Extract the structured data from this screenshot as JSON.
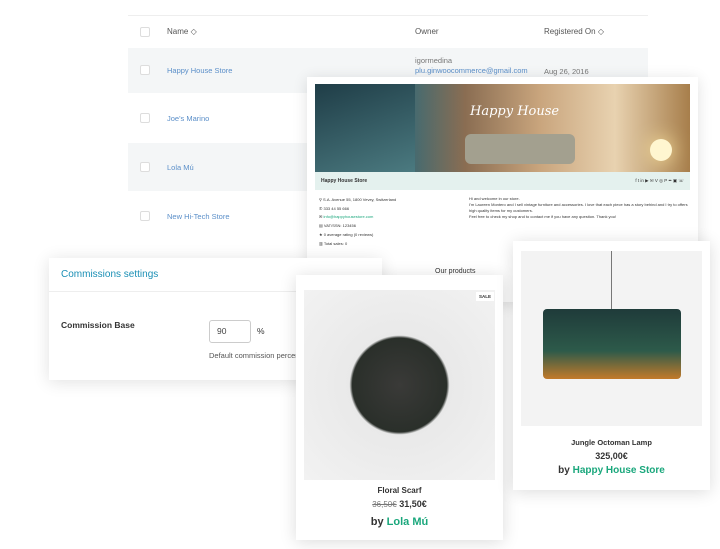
{
  "table": {
    "headers": {
      "name": "Name",
      "owner": "Owner",
      "registered": "Registered On"
    },
    "rows": [
      {
        "name": "Happy House Store",
        "owner": "igormedina",
        "email": "plu.ginwoocommerce@gmail.com",
        "date": "Aug 26, 2016"
      },
      {
        "name": "Joe's Marino"
      },
      {
        "name": "Lola Mú"
      },
      {
        "name": "New Hi-Tech Store"
      }
    ]
  },
  "store": {
    "banner_logo": "Happy House",
    "name": "Happy House Store",
    "social": "f  t  in  ▶  ✉  V  ◎  P  ••  ▣  ☏",
    "details": [
      "S.A. Avenue 55, 1800 Vevey, Switzerland",
      "333 44 55 666",
      "info@happyhousestore.com",
      "VAT/SSN: 123456",
      "0 average rating (0 reviews)",
      "Total sales: 0"
    ],
    "about": [
      "Hi and welcome in our store.",
      "I'm Laureen Montero and I sell vintage furniture and accessories. I love that each piece has a story behind and I try to offers high quality items for my customers.",
      "Feel free to check my shop and to contact me if you have any question. Thank you!"
    ],
    "our_products": "Our products"
  },
  "commissions": {
    "title": "Commissions settings",
    "label": "Commission Base",
    "value": "90",
    "unit": "%",
    "help": "Default commission percentage"
  },
  "product1": {
    "badge": "SALE",
    "name": "Floral Scarf",
    "old_price": "36,50€",
    "price": "31,50€",
    "by": "by",
    "vendor": "Lola Mú"
  },
  "product2": {
    "name": "Jungle Octoman Lamp",
    "price": "325,00€",
    "by": "by",
    "vendor": "Happy House Store"
  },
  "colors": {
    "accent": "#1a8fb5",
    "vendor": "#1aa77c",
    "link": "#5b8fc9"
  }
}
